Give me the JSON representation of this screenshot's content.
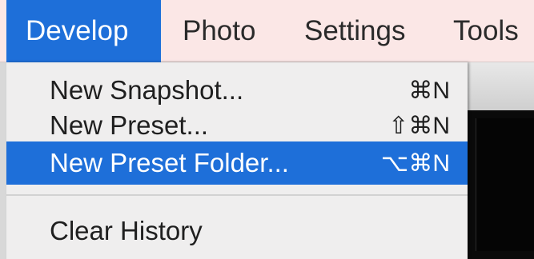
{
  "menubar": {
    "items": [
      {
        "label": "Develop"
      },
      {
        "label": "Photo"
      },
      {
        "label": "Settings"
      },
      {
        "label": "Tools"
      }
    ]
  },
  "dropdown": {
    "items": [
      {
        "label": "New Snapshot...",
        "shortcut": "⌘N"
      },
      {
        "label": "New Preset...",
        "shortcut": "⇧⌘N"
      },
      {
        "label": "New Preset Folder...",
        "shortcut": "⌥⌘N"
      },
      {
        "label": "Clear History",
        "shortcut": ""
      }
    ]
  },
  "colors": {
    "menubar_bg": "#fbe7e6",
    "highlight": "#1e6fd9",
    "menu_bg": "#efeeee"
  }
}
